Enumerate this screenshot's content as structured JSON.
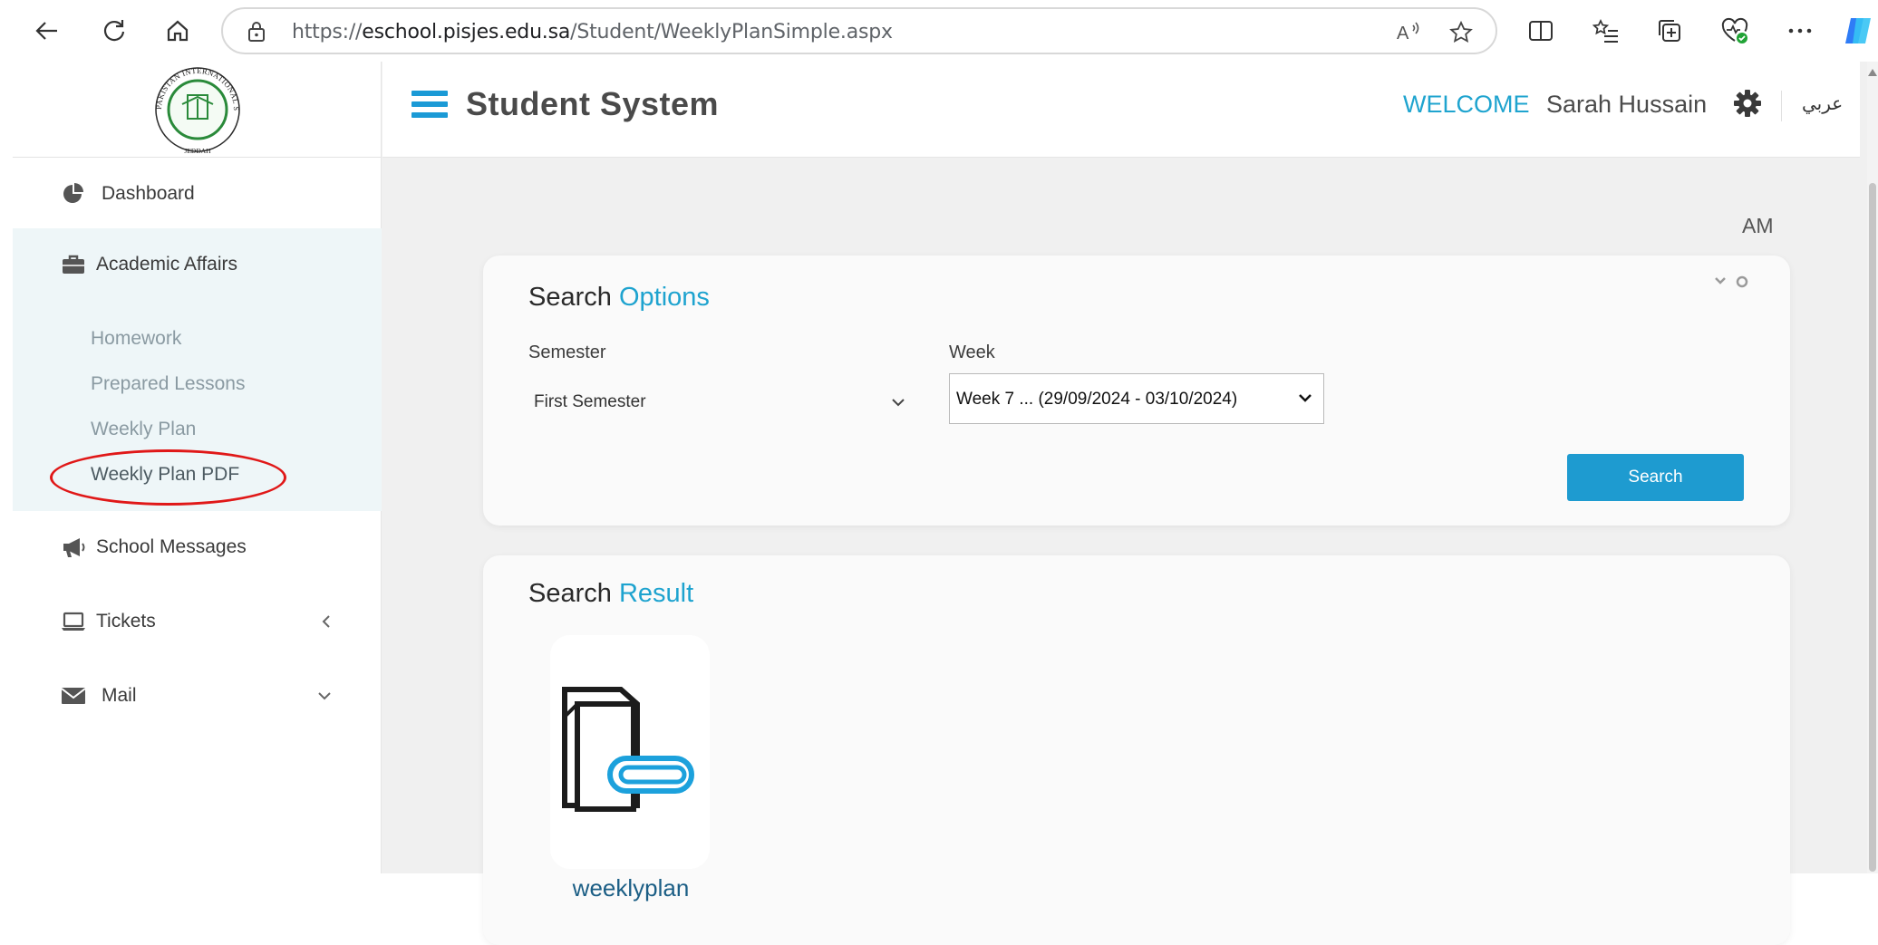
{
  "browser": {
    "url_prefix": "https://",
    "url_host": "eschool.pisjes.edu.sa",
    "url_path": "/Student/WeeklyPlanSimple.aspx"
  },
  "header": {
    "title": "Student System",
    "welcome": "WELCOME",
    "username": "Sarah Hussain",
    "lang": "عربي"
  },
  "logo": {
    "ring_text": "PAKISTAN INTERNATIONAL SCHOOL",
    "city": "JEDDAH"
  },
  "sidebar": {
    "items": [
      {
        "label": "Dashboard",
        "icon": "pie-chart-icon"
      },
      {
        "label": "Academic Affairs",
        "icon": "briefcase-icon"
      },
      {
        "label": "School Messages",
        "icon": "megaphone-icon"
      },
      {
        "label": "Tickets",
        "icon": "laptop-icon"
      },
      {
        "label": "Mail",
        "icon": "envelope-icon"
      }
    ],
    "academic_sub": [
      {
        "label": "Homework"
      },
      {
        "label": "Prepared Lessons"
      },
      {
        "label": "Weekly Plan"
      },
      {
        "label": "Weekly Plan PDF"
      }
    ]
  },
  "clock_fragment": "AM",
  "search_options": {
    "title_a": "Search ",
    "title_b": "Options",
    "semester_label": "Semester",
    "semester_value": "First Semester",
    "week_label": "Week",
    "week_value": "Week 7 ... (29/09/2024 - 03/10/2024)",
    "search_button": "Search"
  },
  "search_result": {
    "title_a": "Search ",
    "title_b": "Result",
    "files": [
      {
        "name": "weeklyplan"
      }
    ]
  },
  "colors": {
    "accent": "#1ea3cf",
    "button": "#1e9bd0",
    "annotation": "#e01818"
  }
}
